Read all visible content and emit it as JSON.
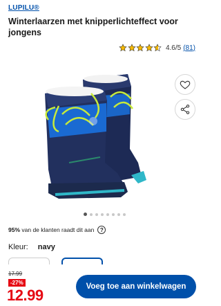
{
  "header": {
    "brand": "LUPILU®",
    "title": "Winterlaarzen met knipperlichteffect voor jongens"
  },
  "rating": {
    "stars": 4.6,
    "value_text": "4.6/5",
    "count_text": "(81)"
  },
  "gallery": {
    "image_alt": "navy winter boots",
    "total_images": 8,
    "active_index": 0
  },
  "advice": {
    "percent": "95%",
    "text": "van de klanten raadt dit aan",
    "help_icon": "?"
  },
  "variant": {
    "label": "Kleur:",
    "value": "navy"
  },
  "pricing": {
    "old_price": "17.99",
    "discount": "-27%",
    "price": "12.99"
  },
  "actions": {
    "add_to_cart": "Voeg toe aan winkelwagen",
    "favorite_icon": "heart-icon",
    "share_icon": "share-icon"
  },
  "colors": {
    "brand_blue": "#0050aa",
    "price_red": "#e60a14",
    "star_yellow": "#f5b800"
  }
}
